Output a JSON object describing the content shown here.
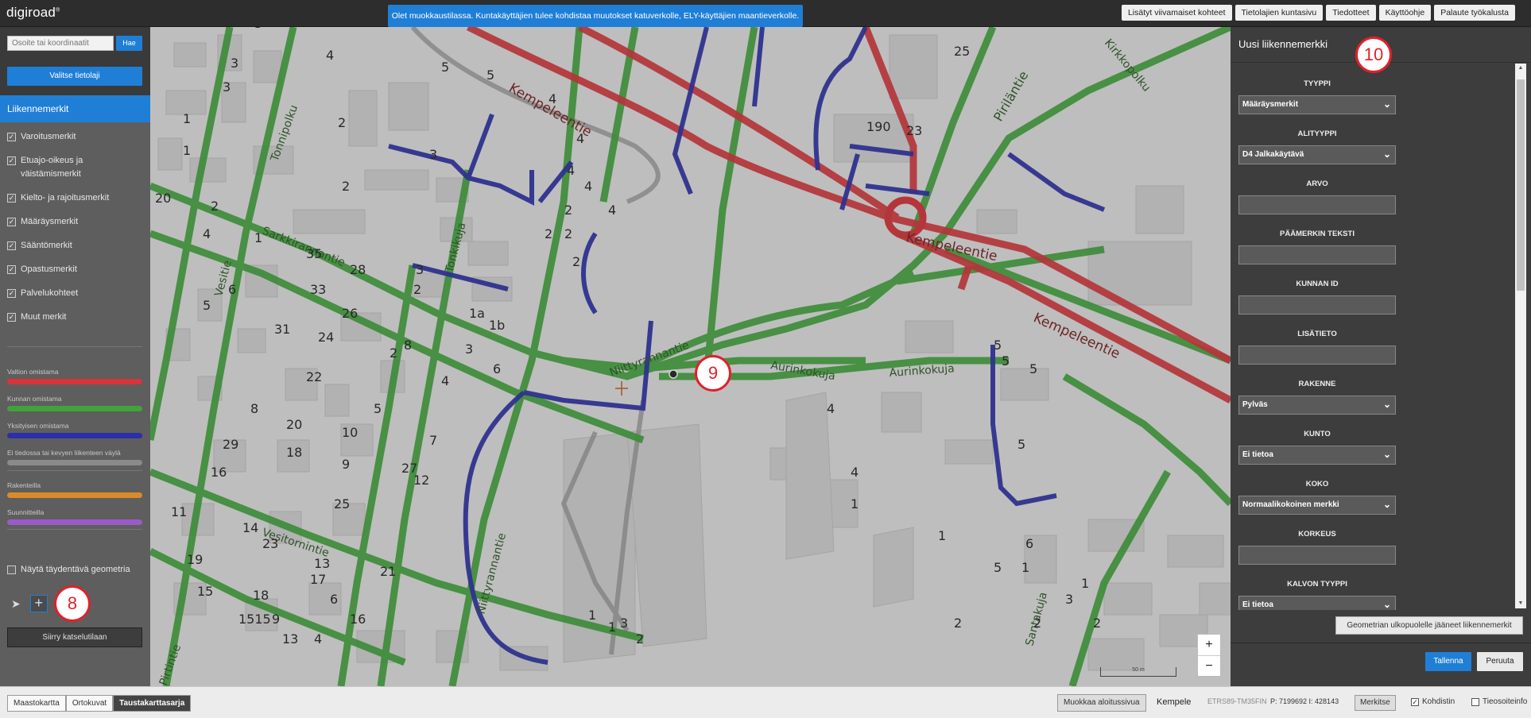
{
  "app": {
    "logo": "digiroad",
    "logo_mark": "®",
    "notice": "Olet muokkaustilassa. Kuntakäyttäjien tulee kohdistaa muutokset katuverkolle, ELY-käyttäjien maantieverkolle."
  },
  "top_links": [
    "Lisätyt viivamaiset kohteet",
    "Tietolajien kuntasivu",
    "Tiedotteet",
    "Käyttöohje",
    "Palaute työkalusta"
  ],
  "left_panel": {
    "search_placeholder": "Osoite tai koordinaatit",
    "search_button": "Hae",
    "select_layer_button": "Valitse tietolaji",
    "layer_title": "Liikennemerkit",
    "checkboxes": [
      {
        "label": "Varoitusmerkit",
        "checked": true
      },
      {
        "label": "Etuajo-oikeus ja väistämismerkit",
        "checked": true
      },
      {
        "label": "Kielto- ja rajoitusmerkit",
        "checked": true
      },
      {
        "label": "Määräysmerkit",
        "checked": true
      },
      {
        "label": "Sääntömerkit",
        "checked": true
      },
      {
        "label": "Opastusmerkit",
        "checked": true
      },
      {
        "label": "Palvelukohteet",
        "checked": true
      },
      {
        "label": "Muut merkit",
        "checked": true
      }
    ],
    "legend": [
      {
        "label": "Valtion omistama",
        "color": "#d8343a"
      },
      {
        "label": "Kunnan omistama",
        "color": "#3fa43a"
      },
      {
        "label": "Yksityisen omistama",
        "color": "#2c2fa8"
      },
      {
        "label": "Ei tiedossa tai kevyen liikenteen väylä",
        "color": "#8a8a8a"
      },
      {
        "label": "Rakenteilla",
        "color": "#d98b2a"
      },
      {
        "label": "Suunnitteilla",
        "color": "#9a5bc8"
      }
    ],
    "geometry_checkbox": "Näytä täydentävä geometria",
    "view_mode_button": "Siirry katselutilaan",
    "step_marker": "8"
  },
  "map": {
    "step_marker": "9",
    "zoom_in": "+",
    "zoom_out": "−",
    "scale_label": "50 m",
    "labels": [
      "Kempeleentie",
      "Kempeleentie",
      "Kempeleentie",
      "Piriläntie",
      "Kirkkopolku",
      "Aurinkokuja",
      "Aurinkokuja",
      "Niittyrannantie",
      "Niittyrannantie",
      "Sarkkirannantie",
      "Vesitornintie",
      "Tonkikuja",
      "Tonnipolku",
      "Santakuja",
      "Vesitie",
      "Pirtintie"
    ],
    "numbers": [
      "5",
      "3",
      "4",
      "3",
      "5",
      "5",
      "1",
      "1",
      "2",
      "2",
      "3",
      "4",
      "4",
      "4",
      "4",
      "4",
      "2",
      "2",
      "2",
      "2",
      "190",
      "25",
      "23",
      "20",
      "2",
      "4",
      "1",
      "35",
      "28",
      "3",
      "33",
      "2",
      "6",
      "5",
      "26",
      "1a",
      "1b",
      "31",
      "24",
      "3",
      "8",
      "2",
      "22",
      "6",
      "4",
      "8",
      "5",
      "20",
      "10",
      "7",
      "29",
      "18",
      "9",
      "27",
      "16",
      "12",
      "11",
      "25",
      "14",
      "23",
      "13",
      "21",
      "19",
      "17",
      "15",
      "18",
      "6",
      "16",
      "1515",
      "9",
      "4",
      "13",
      "1",
      "1",
      "2",
      "3",
      "5",
      "5",
      "5",
      "4",
      "4",
      "5",
      "1",
      "6",
      "1",
      "5",
      "2",
      "2",
      "1",
      "2",
      "3",
      "1"
    ]
  },
  "right_panel": {
    "title": "Uusi liikennemerkki",
    "step_marker": "10",
    "fields": [
      {
        "label": "TYYPPI",
        "type": "select",
        "value": "Määräysmerkit"
      },
      {
        "label": "ALITYYPPI",
        "type": "select",
        "value": "D4 Jalkakäytävä"
      },
      {
        "label": "ARVO",
        "type": "input",
        "value": ""
      },
      {
        "label": "PÄÄMERKIN TEKSTI",
        "type": "input",
        "value": ""
      },
      {
        "label": "KUNNAN ID",
        "type": "input",
        "value": ""
      },
      {
        "label": "LISÄTIETO",
        "type": "input",
        "value": ""
      },
      {
        "label": "RAKENNE",
        "type": "select",
        "value": "Pylväs"
      },
      {
        "label": "KUNTO",
        "type": "select",
        "value": "Ei tietoa"
      },
      {
        "label": "KOKO",
        "type": "select",
        "value": "Normaalikokoinen merkki"
      },
      {
        "label": "KORKEUS",
        "type": "input",
        "value": ""
      },
      {
        "label": "KALVON TYYPPI",
        "type": "select",
        "value": "Ei tietoa"
      }
    ],
    "outside_geometry_button": "Geometrian ulkopuolelle jääneet liikennemerkit",
    "save_button": "Tallenna",
    "cancel_button": "Peruuta"
  },
  "bottom_bar": {
    "background_tabs": [
      {
        "label": "Maastokartta",
        "active": false
      },
      {
        "label": "Ortokuvat",
        "active": false
      },
      {
        "label": "Taustakarttasarja",
        "active": true
      }
    ],
    "edit_start_page_button": "Muokkaa aloitussivua",
    "municipality": "Kempele",
    "coord_system": "ETRS89-TM35FIN",
    "coords": "P: 7199692  I: 428143",
    "mark_button": "Merkitse",
    "crosshair_label": "Kohdistin",
    "crosshair_checked": true,
    "road_info_label": "Tieosoiteinfo",
    "road_info_checked": false
  }
}
